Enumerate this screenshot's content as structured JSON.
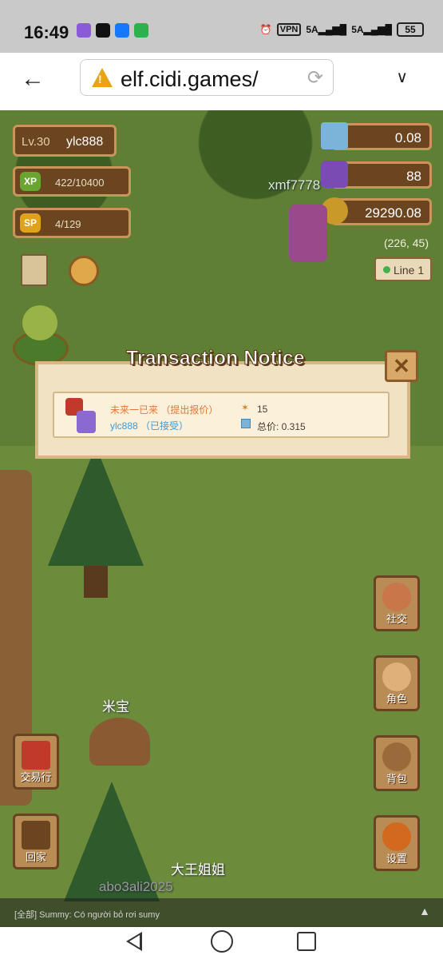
{
  "status_bar": {
    "time": "16:49",
    "vpn": "VPN",
    "signal1": "5A",
    "signal2": "5A",
    "battery": "55"
  },
  "browser": {
    "url": "elf.cidi.games/"
  },
  "hud": {
    "level": "Lv.30",
    "username": "ylc888",
    "xp_label": "XP",
    "xp_value": "422/10400",
    "sp_label": "SP",
    "sp_value": "4/129",
    "currency_1": "0.08",
    "currency_2": "88",
    "currency_3": "29290.08",
    "coordinates": "(226, 45)",
    "line": "Line 1"
  },
  "players": {
    "other": "xmf7778",
    "self": "ylc888",
    "npc1": "米宝",
    "npc2": "大王姐姐",
    "npc3": "abo3ali2025"
  },
  "dialog": {
    "title": "Transaction Notice",
    "seller": "未来一已来 （提出报价）",
    "buyer": "ylc888 （已接受）",
    "quantity": "15",
    "total": "总价:  0.315"
  },
  "menu": {
    "social": "社交",
    "role": "角色",
    "bag": "背包",
    "settings": "设置",
    "trade": "交易行",
    "home": "回家"
  },
  "chat": {
    "message": "[全部] Summy: Có người bỏ rơi sumy"
  },
  "colors": {
    "panel_brown": "#6b4420",
    "panel_border": "#c9955b",
    "dialog_bg": "#f1e2c4",
    "seller_orange": "#e2773a",
    "buyer_blue": "#3a9ad8"
  }
}
